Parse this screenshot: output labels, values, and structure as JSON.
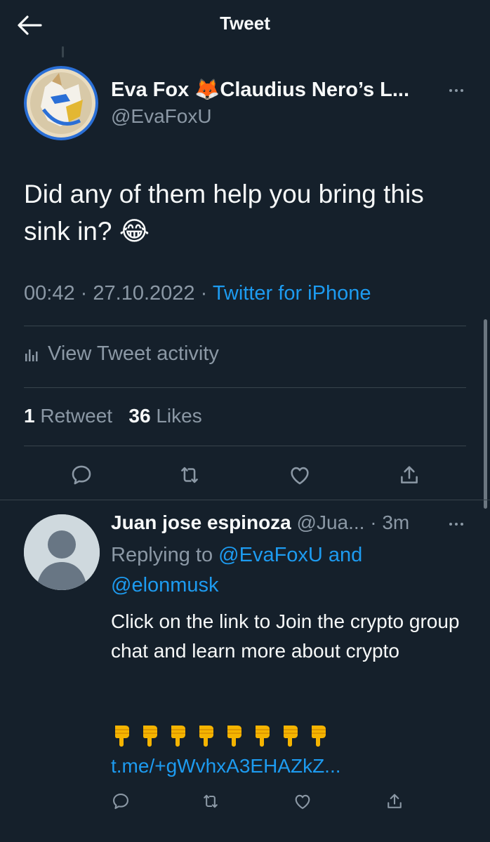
{
  "header": {
    "title": "Tweet",
    "back_icon": "arrow-left-icon"
  },
  "main_tweet": {
    "author_name": "Eva Fox 🦊Claudius Nero’s L...",
    "author_handle": "@EvaFoxU",
    "text": "Did any of them help you bring this sink in? 😂",
    "time": "00:42",
    "date": "27.10.2022",
    "source": "Twitter for iPhone",
    "separator": "·",
    "activity_label": "View Tweet activity",
    "retweet_count": "1",
    "retweet_label": "Retweet",
    "likes_count": "36",
    "likes_label": "Likes"
  },
  "reply": {
    "author_name": "Juan jose espinoza",
    "author_handle": "@Jua...",
    "separator": "·",
    "time": "3m",
    "replying_prefix": "Replying to",
    "replying_user1": "@EvaFoxU",
    "replying_and": "and",
    "replying_user2": "@elonmusk",
    "text": "Click on the link to Join the crypto group chat and learn more about crypto",
    "emoji": "👇👇👇👇👇👇👇👇",
    "link": "t.me/+gWvhxA3EHAZkZ..."
  },
  "icons": {
    "reply": "reply-icon",
    "retweet": "retweet-icon",
    "like": "heart-icon",
    "share": "share-icon",
    "more": "more-icon",
    "activity": "bar-chart-icon"
  },
  "colors": {
    "background": "#15202b",
    "text": "#f7f9f9",
    "muted": "#8b98a5",
    "accent": "#1d9bf0",
    "divider": "#38444d"
  }
}
